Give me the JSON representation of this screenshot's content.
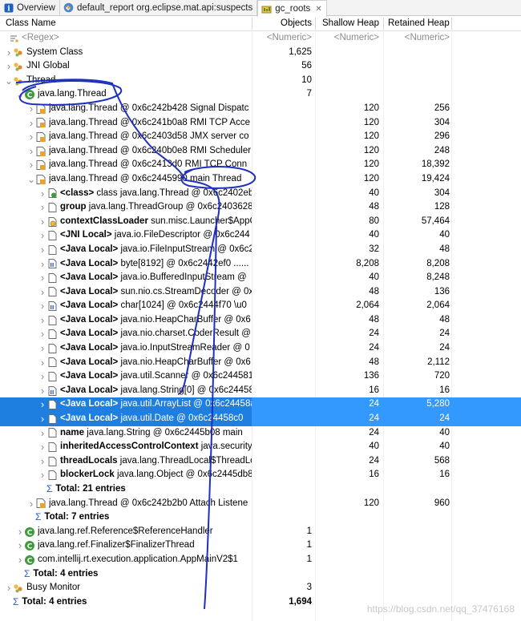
{
  "tabs": [
    {
      "label": "Overview",
      "icon": "info-icon",
      "active": false
    },
    {
      "label": "default_report  org.eclipse.mat.api:suspects",
      "icon": "report-icon",
      "active": false
    },
    {
      "label": "gc_roots",
      "icon": "histogram-icon",
      "active": true
    }
  ],
  "columns": {
    "name": "Class Name",
    "objects": "Objects",
    "shallow": "Shallow Heap",
    "retained": "Retained Heap"
  },
  "filter": {
    "name": "<Regex>",
    "objects": "<Numeric>",
    "shallow": "<Numeric>",
    "retained": "<Numeric>"
  },
  "rows": [
    {
      "indent": 0,
      "tw": "collapsed",
      "icon": "class-group-icon",
      "name": "System Class",
      "obj": "1,625",
      "sh": "",
      "rt": ""
    },
    {
      "indent": 0,
      "tw": "collapsed",
      "icon": "class-group-icon",
      "name": "JNI Global",
      "obj": "56",
      "sh": "",
      "rt": ""
    },
    {
      "indent": 0,
      "tw": "expanded",
      "icon": "class-group-icon",
      "name": "Thread",
      "obj": "10",
      "sh": "",
      "rt": ""
    },
    {
      "indent": 1,
      "tw": "expanded",
      "icon": "class-icon",
      "name": "java.lang.Thread",
      "obj": "7",
      "sh": "",
      "rt": ""
    },
    {
      "indent": 2,
      "tw": "collapsed",
      "icon": "object-icon",
      "name": "java.lang.Thread @ 0x6c242b428  Signal Dispatc",
      "obj": "",
      "sh": "120",
      "rt": "256"
    },
    {
      "indent": 2,
      "tw": "collapsed",
      "icon": "object-icon",
      "name": "java.lang.Thread @ 0x6c241b0a8  RMI TCP Acce",
      "obj": "",
      "sh": "120",
      "rt": "304"
    },
    {
      "indent": 2,
      "tw": "collapsed",
      "icon": "object-icon",
      "name": "java.lang.Thread @ 0x6c2403d58  JMX server co",
      "obj": "",
      "sh": "120",
      "rt": "296"
    },
    {
      "indent": 2,
      "tw": "collapsed",
      "icon": "object-icon",
      "name": "java.lang.Thread @ 0x6c240b0e8  RMI Scheduler",
      "obj": "",
      "sh": "120",
      "rt": "248"
    },
    {
      "indent": 2,
      "tw": "collapsed",
      "icon": "object-icon",
      "name": "java.lang.Thread @ 0x6c2413d0  RMI TCP Conn",
      "obj": "",
      "sh": "120",
      "rt": "18,392"
    },
    {
      "indent": 2,
      "tw": "expanded",
      "icon": "object-icon",
      "name": "java.lang.Thread @ 0x6c2445990  main Thread",
      "obj": "",
      "sh": "120",
      "rt": "19,424"
    },
    {
      "indent": 3,
      "tw": "collapsed",
      "icon": "class-ref-icon",
      "bold": "<class>",
      "name": "class java.lang.Thread @ 0x6c2402eb",
      "obj": "",
      "sh": "40",
      "rt": "304"
    },
    {
      "indent": 3,
      "tw": "collapsed",
      "icon": "field-icon",
      "bold": "group",
      "name": "java.lang.ThreadGroup @ 0x6c2403628",
      "obj": "",
      "sh": "48",
      "rt": "128"
    },
    {
      "indent": 3,
      "tw": "collapsed",
      "icon": "loader-icon",
      "bold": "contextClassLoader",
      "name": "sun.misc.Launcher$AppC",
      "obj": "",
      "sh": "80",
      "rt": "57,464"
    },
    {
      "indent": 3,
      "tw": "collapsed",
      "icon": "field-icon",
      "bold": "<JNI Local>",
      "name": "java.io.FileDescriptor @ 0x6c244",
      "obj": "",
      "sh": "40",
      "rt": "40"
    },
    {
      "indent": 3,
      "tw": "collapsed",
      "icon": "field-icon",
      "bold": "<Java Local>",
      "name": "java.io.FileInputStream @ 0x6c2",
      "obj": "",
      "sh": "32",
      "rt": "48"
    },
    {
      "indent": 3,
      "tw": "collapsed",
      "icon": "array-icon",
      "bold": "<Java Local>",
      "name": "byte[8192] @ 0x6c2442ef0  ......",
      "obj": "",
      "sh": "8,208",
      "rt": "8,208"
    },
    {
      "indent": 3,
      "tw": "collapsed",
      "icon": "field-icon",
      "bold": "<Java Local>",
      "name": "java.io.BufferedInputStream @",
      "obj": "",
      "sh": "40",
      "rt": "8,248"
    },
    {
      "indent": 3,
      "tw": "collapsed",
      "icon": "field-icon",
      "bold": "<Java Local>",
      "name": "sun.nio.cs.StreamDecoder @ 0x",
      "obj": "",
      "sh": "48",
      "rt": "136"
    },
    {
      "indent": 3,
      "tw": "collapsed",
      "icon": "array-icon",
      "bold": "<Java Local>",
      "name": "char[1024] @ 0x6c2444f70  \\u0",
      "obj": "",
      "sh": "2,064",
      "rt": "2,064"
    },
    {
      "indent": 3,
      "tw": "collapsed",
      "icon": "field-icon",
      "bold": "<Java Local>",
      "name": "java.nio.HeapCharBuffer @ 0x6",
      "obj": "",
      "sh": "48",
      "rt": "48"
    },
    {
      "indent": 3,
      "tw": "collapsed",
      "icon": "field-icon",
      "bold": "<Java Local>",
      "name": "java.nio.charset.CoderResult @",
      "obj": "",
      "sh": "24",
      "rt": "24"
    },
    {
      "indent": 3,
      "tw": "collapsed",
      "icon": "field-icon",
      "bold": "<Java Local>",
      "name": "java.io.InputStreamReader @ 0",
      "obj": "",
      "sh": "24",
      "rt": "24"
    },
    {
      "indent": 3,
      "tw": "collapsed",
      "icon": "field-icon",
      "bold": "<Java Local>",
      "name": "java.nio.HeapCharBuffer @ 0x6",
      "obj": "",
      "sh": "48",
      "rt": "2,112"
    },
    {
      "indent": 3,
      "tw": "collapsed",
      "icon": "field-icon",
      "bold": "<Java Local>",
      "name": "java.util.Scanner @ 0x6c244581",
      "obj": "",
      "sh": "136",
      "rt": "720"
    },
    {
      "indent": 3,
      "tw": "collapsed",
      "icon": "array-icon",
      "bold": "<Java Local>",
      "name": "java.lang.String[0] @ 0x6c24458",
      "obj": "",
      "sh": "16",
      "rt": "16"
    },
    {
      "indent": 3,
      "tw": "collapsed",
      "icon": "field-icon",
      "bold": "<Java Local>",
      "name": "java.util.ArrayList @ 0x6c24458a",
      "obj": "",
      "sh": "24",
      "rt": "5,280",
      "sel": true
    },
    {
      "indent": 3,
      "tw": "collapsed",
      "icon": "field-icon",
      "bold": "<Java Local>",
      "name": "java.util.Date @ 0x6c24458c0",
      "obj": "",
      "sh": "24",
      "rt": "24",
      "sel": true
    },
    {
      "indent": 3,
      "tw": "collapsed",
      "icon": "field-icon",
      "bold": "name",
      "name": "java.lang.String @ 0x6c2445b08  main",
      "obj": "",
      "sh": "24",
      "rt": "40"
    },
    {
      "indent": 3,
      "tw": "collapsed",
      "icon": "field-icon",
      "bold": "inheritedAccessControlContext",
      "name": "java.security.",
      "obj": "",
      "sh": "40",
      "rt": "40"
    },
    {
      "indent": 3,
      "tw": "collapsed",
      "icon": "field-icon",
      "bold": "threadLocals",
      "name": "java.lang.ThreadLocal$ThreadLo",
      "obj": "",
      "sh": "24",
      "rt": "568"
    },
    {
      "indent": 3,
      "tw": "collapsed",
      "icon": "field-icon",
      "bold": "blockerLock",
      "name": "java.lang.Object @ 0x6c2445db8",
      "obj": "",
      "sh": "16",
      "rt": "16"
    },
    {
      "indent": 3,
      "tw": "none",
      "icon": "sigma",
      "bold": "Total: 21 entries",
      "name": "",
      "obj": "",
      "sh": "",
      "rt": ""
    },
    {
      "indent": 2,
      "tw": "collapsed",
      "icon": "object-icon",
      "name": "java.lang.Thread @ 0x6c242b2b0  Attach Listene",
      "obj": "",
      "sh": "120",
      "rt": "960"
    },
    {
      "indent": 2,
      "tw": "none",
      "icon": "sigma",
      "bold": "Total: 7 entries",
      "name": "",
      "obj": "",
      "sh": "",
      "rt": ""
    },
    {
      "indent": 1,
      "tw": "collapsed",
      "icon": "class-icon",
      "name": "java.lang.ref.Reference$ReferenceHandler",
      "obj": "1",
      "sh": "",
      "rt": ""
    },
    {
      "indent": 1,
      "tw": "collapsed",
      "icon": "class-icon",
      "name": "java.lang.ref.Finalizer$FinalizerThread",
      "obj": "1",
      "sh": "",
      "rt": ""
    },
    {
      "indent": 1,
      "tw": "collapsed",
      "icon": "class-icon",
      "name": "com.intellij.rt.execution.application.AppMainV2$1",
      "obj": "1",
      "sh": "",
      "rt": ""
    },
    {
      "indent": 1,
      "tw": "none",
      "icon": "sigma",
      "bold": "Total: 4 entries",
      "name": "",
      "obj": "",
      "sh": "",
      "rt": ""
    },
    {
      "indent": 0,
      "tw": "collapsed",
      "icon": "class-group-icon",
      "name": "Busy Monitor",
      "obj": "3",
      "sh": "",
      "rt": ""
    },
    {
      "indent": 0,
      "tw": "none",
      "icon": "sigma",
      "bold": "Total: 4 entries",
      "name": "",
      "obj": "1,694",
      "sh": "",
      "rt": ""
    }
  ],
  "watermark": "https://blog.csdn.net/qq_37476168"
}
